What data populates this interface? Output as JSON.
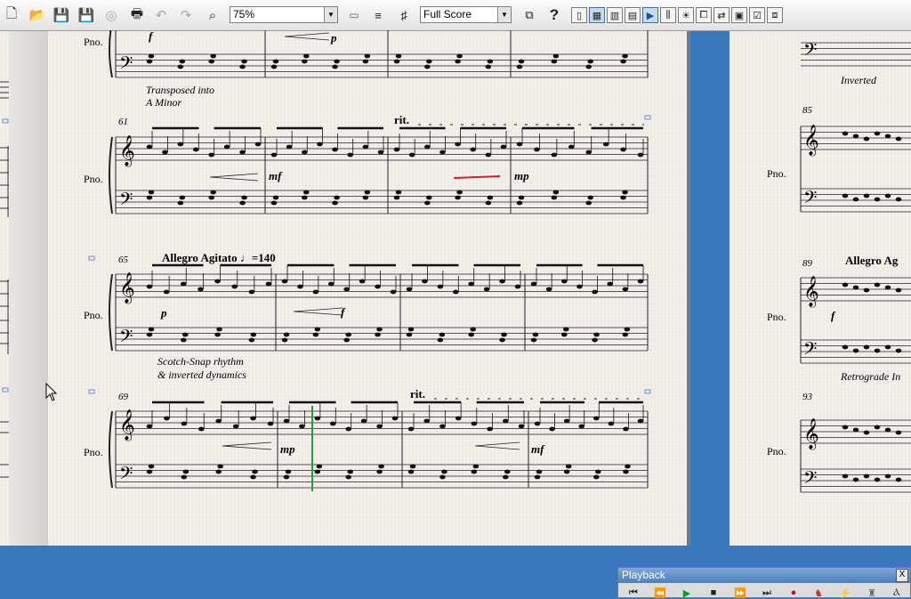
{
  "toolbar": {
    "zoom": "75%",
    "view": "Full Score",
    "buttons": [
      {
        "name": "new-icon",
        "glyph": "🗋"
      },
      {
        "name": "open-icon",
        "glyph": "📂"
      },
      {
        "name": "save-icon",
        "glyph": "💾"
      },
      {
        "name": "save-all-icon",
        "glyph": "💾"
      },
      {
        "name": "cd-icon",
        "glyph": "◎"
      },
      {
        "name": "print-icon",
        "glyph": "🖶"
      },
      {
        "name": "undo-icon",
        "glyph": "↶"
      },
      {
        "name": "redo-icon",
        "glyph": "↷"
      },
      {
        "name": "lasso-icon",
        "glyph": "⌕"
      }
    ],
    "help": "?"
  },
  "score": {
    "instrument": "Pno.",
    "rit": "rit.",
    "measure_numbers": [
      "61",
      "65",
      "69",
      "85",
      "89",
      "93"
    ],
    "dynamics": [
      "mf",
      "mp",
      "p",
      "f",
      "mp",
      "mf",
      "f"
    ],
    "tempo": "Allegro Agitato",
    "tempo_value": "♩=140",
    "tempo_right": "Allegro Ag",
    "annotations": {
      "transposed_1": "Transposed into",
      "transposed_2": "A Minor",
      "scotch_1": "Scotch-Snap rhythm",
      "scotch_2": "& inverted dynamics",
      "inverted": "Inverted",
      "retrograde": "Retrograde In"
    }
  },
  "playback": {
    "title": "Playback",
    "close": "X",
    "controls": [
      {
        "name": "rewind-start-icon",
        "glyph": "⏮"
      },
      {
        "name": "rewind-icon",
        "glyph": "⏪"
      },
      {
        "name": "play-icon",
        "glyph": "▶"
      },
      {
        "name": "stop-icon",
        "glyph": "■"
      },
      {
        "name": "fast-forward-icon",
        "glyph": "⏩"
      },
      {
        "name": "forward-end-icon",
        "glyph": "⏭"
      },
      {
        "name": "record-icon",
        "glyph": "●"
      }
    ]
  }
}
